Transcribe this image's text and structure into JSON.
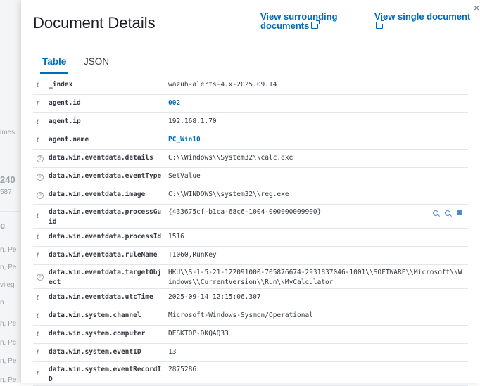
{
  "background": {
    "ghost_texts": [
      "imes",
      "240",
      "587",
      "c",
      "n, Pe",
      "n, Pe",
      "vileg",
      "n",
      "n, Pe",
      "n, Pe",
      "n, Pe",
      "n, Pe"
    ]
  },
  "flyout": {
    "title": "Document Details",
    "links": {
      "surrounding": "View surrounding documents",
      "single": "View single document"
    },
    "close_icon": "×",
    "tabs": [
      {
        "label": "Table",
        "active": true
      },
      {
        "label": "JSON",
        "active": false
      }
    ],
    "rows": [
      {
        "type": "t",
        "field": "_index",
        "value": "wazuh-alerts-4.x-2025.09.14",
        "link": false
      },
      {
        "type": "t",
        "field": "agent.id",
        "value": "002",
        "link": true
      },
      {
        "type": "t",
        "field": "agent.ip",
        "value": "192.168.1.70",
        "link": false
      },
      {
        "type": "t",
        "field": "agent.name",
        "value": "PC_Win10",
        "link": true
      },
      {
        "type": "?",
        "field": "data.win.eventdata.details",
        "value": "C:\\\\Windows\\\\System32\\\\calc.exe",
        "link": false
      },
      {
        "type": "?",
        "field": "data.win.eventdata.eventType",
        "value": "SetValue",
        "link": false
      },
      {
        "type": "?",
        "field": "data.win.eventdata.image",
        "value": "C:\\\\WINDOWS\\\\system32\\\\reg.exe",
        "link": false
      },
      {
        "type": "t",
        "field": "data.win.eventdata.processGuid",
        "value": "{433675cf-b1ca-68c6-1004-000000009900}",
        "link": false,
        "actions": true
      },
      {
        "type": "t",
        "field": "data.win.eventdata.processId",
        "value": "1516",
        "link": false
      },
      {
        "type": "t",
        "field": "data.win.eventdata.ruleName",
        "value": "T1060,RunKey",
        "link": false
      },
      {
        "type": "?",
        "field": "data.win.eventdata.targetObject",
        "value": "HKU\\\\S-1-5-21-122091000-705876674-2931837046-1001\\\\SOFTWARE\\\\Microsoft\\\\Windows\\\\CurrentVersion\\\\Run\\\\MyCalculator",
        "link": false
      },
      {
        "type": "t",
        "field": "data.win.eventdata.utcTime",
        "value": "2025-09-14 12:15:06.307",
        "link": false
      },
      {
        "type": "t",
        "field": "data.win.system.channel",
        "value": "Microsoft-Windows-Sysmon/Operational",
        "link": false
      },
      {
        "type": "t",
        "field": "data.win.system.computer",
        "value": "DESKTOP-DKQAQ33",
        "link": false
      },
      {
        "type": "t",
        "field": "data.win.system.eventID",
        "value": "13",
        "link": false
      },
      {
        "type": "t",
        "field": "data.win.system.eventRecordID",
        "value": "2875286",
        "link": false
      }
    ]
  }
}
